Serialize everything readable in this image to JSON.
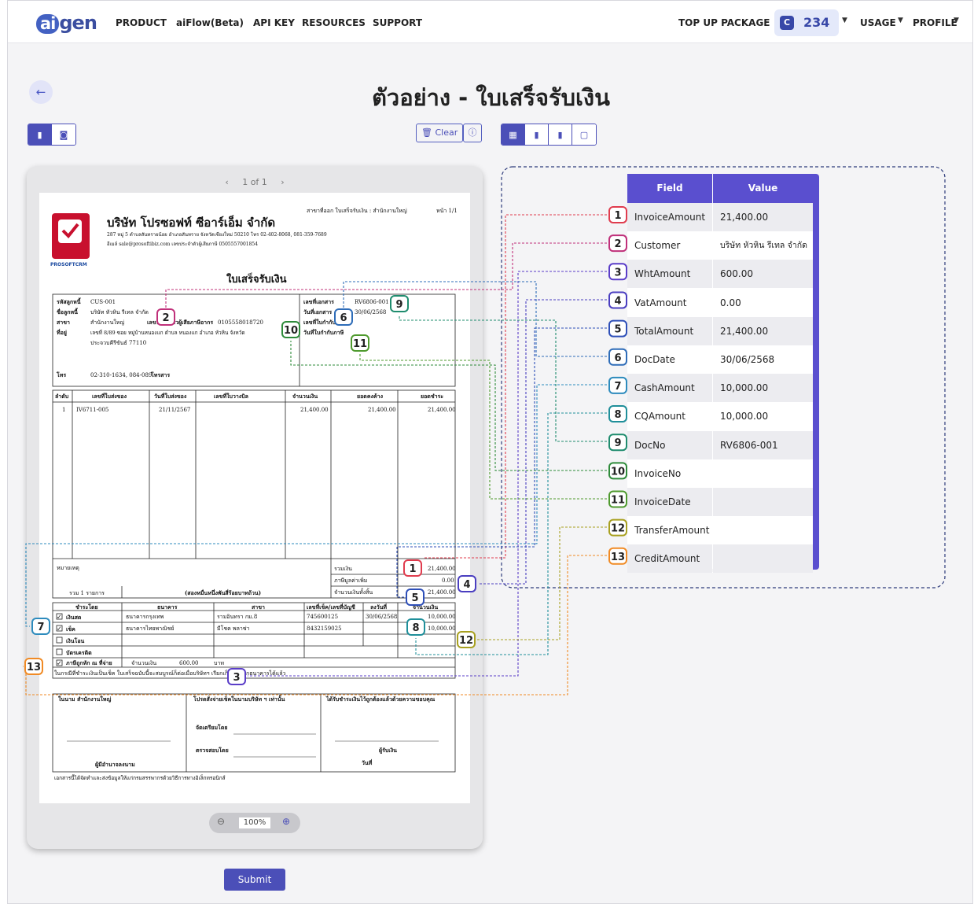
{
  "nav": {
    "brand": "aigen",
    "items": [
      "PRODUCT",
      "aiFlow(Beta)",
      "API KEY",
      "RESOURCES",
      "SUPPORT"
    ],
    "top_up": "TOP UP PACKAGE",
    "credits": "234",
    "usage": "USAGE",
    "profile": "PROFILE"
  },
  "page": {
    "title": "ตัวอย่าง - ใบเสร็จรับเงิน",
    "clear_label": "Clear",
    "submit_label": "Submit"
  },
  "viewer": {
    "pager": "1 of 1",
    "zoom": "100%"
  },
  "table": {
    "headers": [
      "Field",
      "Value"
    ],
    "rows": [
      {
        "n": "1",
        "field": "InvoiceAmount",
        "value": "21,400.00",
        "color": "#e03c4e"
      },
      {
        "n": "2",
        "field": "Customer",
        "value": "บริษัท หัวหิน รีเทล จำกัด",
        "color": "#c0307a"
      },
      {
        "n": "3",
        "field": "WhtAmount",
        "value": "600.00",
        "color": "#5a3dc8"
      },
      {
        "n": "4",
        "field": "VatAmount",
        "value": "0.00",
        "color": "#4a3ec0"
      },
      {
        "n": "5",
        "field": "TotalAmount",
        "value": "21,400.00",
        "color": "#2e4fb8"
      },
      {
        "n": "6",
        "field": "DocDate",
        "value": "30/06/2568",
        "color": "#2e6cb8"
      },
      {
        "n": "7",
        "field": "CashAmount",
        "value": "10,000.00",
        "color": "#2d8bbd"
      },
      {
        "n": "8",
        "field": "CQAmount",
        "value": "10,000.00",
        "color": "#1f8f9a"
      },
      {
        "n": "9",
        "field": "DocNo",
        "value": "RV6806-001",
        "color": "#1f8c6e"
      },
      {
        "n": "10",
        "field": "InvoiceNo",
        "value": "",
        "color": "#2e8b3a"
      },
      {
        "n": "11",
        "field": "InvoiceDate",
        "value": "",
        "color": "#4f9a2e"
      },
      {
        "n": "12",
        "field": "TransferAmount",
        "value": "",
        "color": "#a8a020"
      },
      {
        "n": "13",
        "field": "CreditAmount",
        "value": "",
        "color": "#f08a24"
      }
    ]
  },
  "doc": {
    "branch_head": "สาขาที่ออก ใบเสร็จรับเงิน : สำนักงานใหญ่",
    "page_no": "หน้า 1/1",
    "company": "บริษัท โปรซอฟท์ ซีอาร์เอ็ม จำกัด",
    "addr1": "287 หมู่ 5 ตำบลสันทรายน้อย อำเภอสันทราย จังหวัดเชียงใหม่ 50210 โทร 02-402-8068, 081-359-7689",
    "addr2": "อีเมล์ sale@prosoftibiz.com เลขประจำตัวผู้เสียภาษี 0505557001854",
    "logo_text": "PROSOFTCRM",
    "doc_title": "ใบเสร็จรับเงิน",
    "cust_labels": [
      "รหัสลูกหนี้",
      "ชื่อลูกหนี้",
      "สาขา",
      "ที่อยู่"
    ],
    "cust_values": [
      "CUS-001",
      "บริษัท หัวหิน รีเทล จำกัด",
      "สำนักงานใหญ่",
      "เลขที่ 8/89 ซอย หมู่บ้านหนองแก ตำบล หนองแก อำเภอ หัวหิน จังหวัด"
    ],
    "cust_addr2": "ประจวบคีรีขันธ์ 77110",
    "taxid_label": "เลขประจำตัวผู้เสียภาษีอากร",
    "taxid": "0105558018720",
    "phone_label": "โทร",
    "phone": "02-310-1634, 084-089",
    "fax_label": "โทรสาร",
    "doc_labels": [
      "เลขที่เอกสาร",
      "วันที่เอกสาร",
      "เลขที่ใบกำกับภาษี",
      "วันที่ใบกำกับภาษี"
    ],
    "doc_no": "RV6806-001",
    "doc_date": "30/06/2568",
    "item_headers": [
      "ลำดับ",
      "เลขที่ใบส่งของ",
      "วันที่ใบส่งของ",
      "เลขที่ใบวางบิล",
      "จำนวนเงิน",
      "ยอดคงค้าง",
      "ยอดชำระ"
    ],
    "item_row": [
      "1",
      "IV6711-005",
      "21/11/2567",
      "",
      "21,400.00",
      "21,400.00",
      "21,400.00"
    ],
    "remark": "หมายเหตุ",
    "sum_labels": [
      "รวมเงิน",
      "ภาษีมูลค่าเพิ่ม",
      "จำนวนเงินทั้งสิ้น"
    ],
    "sum_values": [
      "21,400.00",
      "0.00",
      "21,400.00"
    ],
    "count": "รวม 1 รายการ",
    "amount_words": "(สองหมื่นหนึ่งพันสี่ร้อยบาทถ้วน)",
    "pay_headers": [
      "ชำระโดย",
      "ธนาคาร",
      "สาขา",
      "เลขที่เช็ค/เลขที่บัญชี",
      "ลงวันที่",
      "จำนวนเงิน"
    ],
    "pay_methods": [
      "เงินสด",
      "เช็ค",
      "เงินโอน",
      "บัตรเครดิต",
      "ภาษีถูกหัก ณ ที่จ่าย"
    ],
    "pay_rows": [
      [
        "ธนาคารกรุงเทพ",
        "รามอินทรา กม.8",
        "745600125",
        "30/06/2568",
        "10,000.00"
      ],
      [
        "ธนาคารไทยพาณิชย์",
        "มีโชค พลาซ่า",
        "8432159025",
        "",
        "10,000.00"
      ]
    ],
    "wht_label": "จำนวนเงิน",
    "wht_value": "600.00",
    "baht": "บาท",
    "cheque_note": "ในกรณีที่ชำระเงินเป็นเช็ค ใบเสร็จฉบับนี้จะสมบูรณ์ก็ต่อเมื่อบริษัทฯ เรียกเก็บเงินจากธนาคารได้แล้ว",
    "sig1": "ในนาม สำนักงานใหญ่",
    "sig1b": "ผู้มีอำนาจลงนาม",
    "sig2": "โปรดสั่งจ่ายเช็คในนามบริษัท ฯ เท่านั้น",
    "sig2a": "จัดเตรียมโดย",
    "sig2b": "ตรวจสอบโดย",
    "sig3": "ได้รับชำระเงินไว้ถูกต้องแล้วด้วยความขอบคุณ",
    "sig3a": "ผู้รับเงิน",
    "sig3b": "วันที่",
    "footer": "เอกสารนี้ได้จัดทำและส่งข้อมูลให้แก่กรมสรรพากรด้วยวิธีการทางอิเล็กทรอนิกส์"
  }
}
